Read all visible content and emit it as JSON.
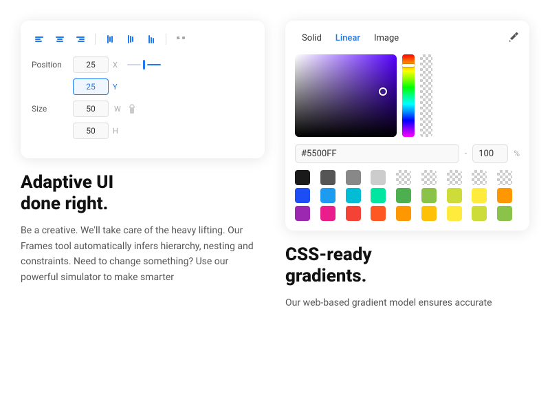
{
  "left": {
    "card": {
      "toolbar": {
        "icons": [
          "align-left",
          "align-center",
          "align-right",
          "align-top",
          "align-middle",
          "align-bottom",
          "distribute"
        ]
      },
      "position_label": "Position",
      "position_x_value": "25",
      "position_x_axis": "X",
      "position_y_value": "25",
      "position_y_axis": "Y",
      "size_label": "Size",
      "size_w_value": "50",
      "size_w_axis": "W",
      "size_h_value": "50",
      "size_h_axis": "H"
    },
    "heading_line1": "Adaptive UI",
    "heading_line2": "done right.",
    "body_text": "Be a creative. We'll take care of the heavy lifting. Our Frames tool automatically infers hierarchy, nesting and constraints. Need to change something? Use our powerful simulator to make smarter"
  },
  "right": {
    "card": {
      "tabs": [
        {
          "label": "Solid",
          "active": false
        },
        {
          "label": "Linear",
          "active": true
        },
        {
          "label": "Image",
          "active": false
        }
      ],
      "eyedropper_icon": "eyedropper",
      "hex_value": "#5500FF",
      "opacity_value": "100",
      "opacity_unit": "%",
      "swatches": [
        "#1a1a1a",
        "#555555",
        "#888888",
        "#bbbbbb",
        "checkered",
        "checkered",
        "checkered",
        "checkered",
        "checkered",
        "#1d4ef5",
        "#1d9bf0",
        "#00bcd4",
        "#00e5a0",
        "#4caf50",
        "#8bc34a",
        "#cddc39",
        "#ffeb3b",
        "#ff9800",
        "#9c27b0",
        "#e91e8c",
        "#f44336",
        "#ff5722",
        "#ff9800",
        "#ffc107",
        "#ffeb3b",
        "#cddc39",
        "#8bc34a"
      ]
    },
    "heading_line1": "CSS-ready",
    "heading_line2": "gradients.",
    "body_text": "Our web-based gradient model ensures accurate"
  }
}
